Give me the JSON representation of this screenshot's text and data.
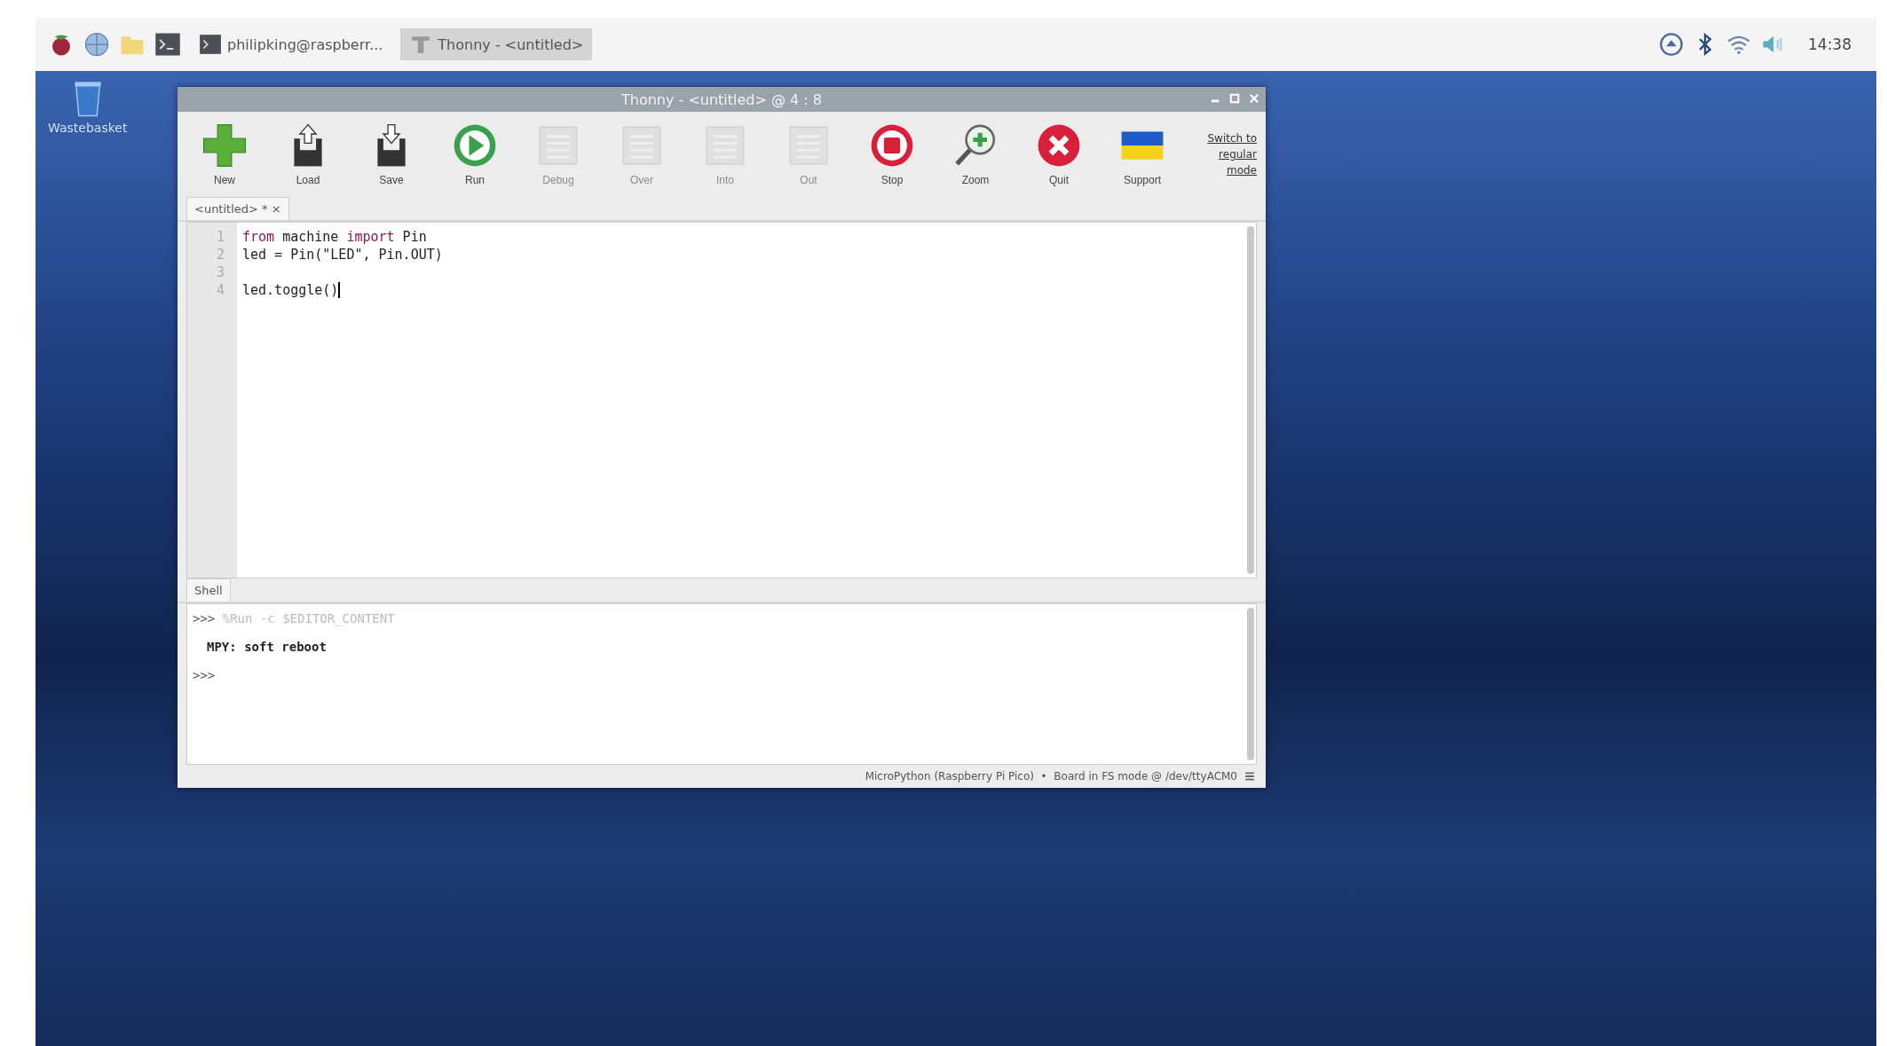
{
  "taskbar": {
    "launchers": [
      {
        "kind": "raspberry"
      },
      {
        "kind": "globe"
      },
      {
        "kind": "folder"
      },
      {
        "kind": "terminal"
      }
    ],
    "tasks": [
      {
        "label": "philipking@raspberr...",
        "kind": "terminal",
        "selected": false
      },
      {
        "label": "Thonny - <untitled>",
        "kind": "thonny",
        "selected": true
      }
    ],
    "tray": {
      "clock": "14:38"
    }
  },
  "desktop_icons": [
    {
      "label": "Wastebasket"
    }
  ],
  "window": {
    "title": "Thonny - <untitled> @ 4 : 8",
    "toolbar": [
      {
        "label": "New",
        "kind": "new",
        "disabled": false
      },
      {
        "label": "Load",
        "kind": "load",
        "disabled": false
      },
      {
        "label": "Save",
        "kind": "save",
        "disabled": false
      },
      {
        "label": "Run",
        "kind": "run",
        "disabled": false
      },
      {
        "label": "Debug",
        "kind": "list",
        "disabled": true
      },
      {
        "label": "Over",
        "kind": "list",
        "disabled": true
      },
      {
        "label": "Into",
        "kind": "list",
        "disabled": true
      },
      {
        "label": "Out",
        "kind": "list",
        "disabled": true
      },
      {
        "label": "Stop",
        "kind": "stop",
        "disabled": false
      },
      {
        "label": "Zoom",
        "kind": "zoom",
        "disabled": false
      },
      {
        "label": "Quit",
        "kind": "quit",
        "disabled": false
      },
      {
        "label": "Support",
        "kind": "flag",
        "disabled": false
      }
    ],
    "mode_link": "Switch to regular mode",
    "editor_tabs": [
      {
        "label": "<untitled> * ×",
        "selected": true
      }
    ],
    "code_lines": [
      {
        "number": "1",
        "segments": [
          {
            "text": "from",
            "kind": "keyword"
          },
          {
            "text": " machine ",
            "kind": "plain"
          },
          {
            "text": "import",
            "kind": "keyword"
          },
          {
            "text": " Pin",
            "kind": "plain"
          }
        ]
      },
      {
        "number": "2",
        "segments": [
          {
            "text": "led = Pin(\"LED\", Pin.OUT)",
            "kind": "plain"
          }
        ]
      },
      {
        "number": "3"
      },
      {
        "number": "4",
        "segments": [
          {
            "text": "led.toggle()",
            "kind": "plain"
          }
        ],
        "cursor": true
      }
    ],
    "shell_tab": "Shell",
    "shell_lines": [
      {
        "kind": "command",
        "prompt": ">>>",
        "text": "%Run -c $EDITOR_CONTENT"
      },
      {
        "kind": "output",
        "text": "MPY: soft reboot"
      },
      {
        "kind": "prompt",
        "prompt": ">>>"
      }
    ],
    "status": "MicroPython (Raspberry Pi Pico)  •  Board in FS mode @ /dev/ttyACM0"
  }
}
